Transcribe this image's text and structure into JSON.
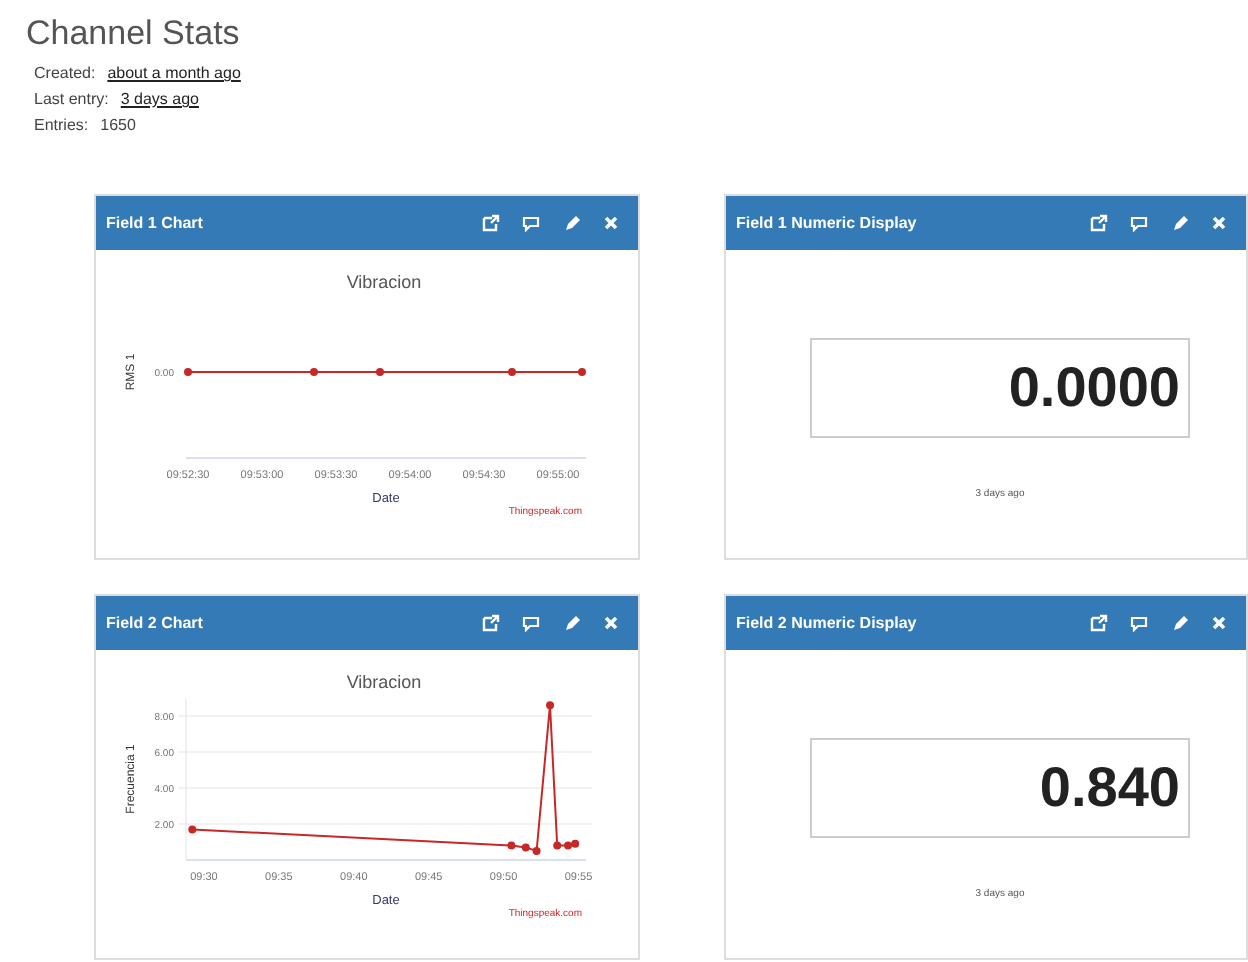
{
  "page_title": "Channel Stats",
  "info": [
    {
      "label": "Created:",
      "value": "about a month ago",
      "kind": "link"
    },
    {
      "label": "Last entry:",
      "value": "3 days ago",
      "kind": "link"
    },
    {
      "label": "Entries:",
      "value": "1650",
      "kind": "text"
    }
  ],
  "widgets": [
    {
      "kind": "chart_picture",
      "title": "Field 1 Chart",
      "credit": "Thingspeak.com",
      "chart_title": "Vibracion",
      "xlabel": "Date",
      "ylabel": "RMS 1",
      "x_tick_labels": [
        "09:52:30",
        "09:53:00",
        "09:53:30",
        "09:54:00",
        "09:54:30",
        "09:55:00"
      ],
      "y_tick_labels": [
        "0.00"
      ]
    },
    {
      "kind": "numeric",
      "title": "Field 1 Numeric Display",
      "value": "0.0000",
      "updated": "3 days ago"
    },
    {
      "kind": "chart",
      "title": "Field 2 Chart",
      "credit": "Thingspeak.com",
      "chart_data": {
        "type": "line",
        "grid": true,
        "title": "Vibracion",
        "xlabel": "Date",
        "ylabel": "Frecuencia 1",
        "x": [
          9.487,
          9.842,
          9.858,
          9.87,
          9.885,
          9.893,
          9.905,
          9.913
        ],
        "series": [
          {
            "color": "#c62828",
            "marker": true,
            "values": [
              1.7,
              0.8,
              0.7,
              0.5,
              8.6,
              0.8,
              0.8,
              0.9
            ]
          }
        ],
        "xlim": [
          9.48,
          9.925
        ],
        "ylim": [
          0,
          9
        ],
        "xticks": [
          {
            "value": 9.5,
            "label": "09:30"
          },
          {
            "value": 9.5833,
            "label": "09:35"
          },
          {
            "value": 9.6667,
            "label": "09:40"
          },
          {
            "value": 9.75,
            "label": "09:45"
          },
          {
            "value": 9.8333,
            "label": "09:50"
          },
          {
            "value": 9.9167,
            "label": "09:55"
          }
        ],
        "yticks": [
          {
            "value": 2,
            "label": "2.00"
          },
          {
            "value": 4,
            "label": "4.00"
          },
          {
            "value": 6,
            "label": "6.00"
          },
          {
            "value": 8,
            "label": "8.00"
          }
        ]
      }
    },
    {
      "kind": "numeric",
      "title": "Field 2 Numeric Display",
      "value": "0.840",
      "updated": "3 days ago"
    }
  ]
}
